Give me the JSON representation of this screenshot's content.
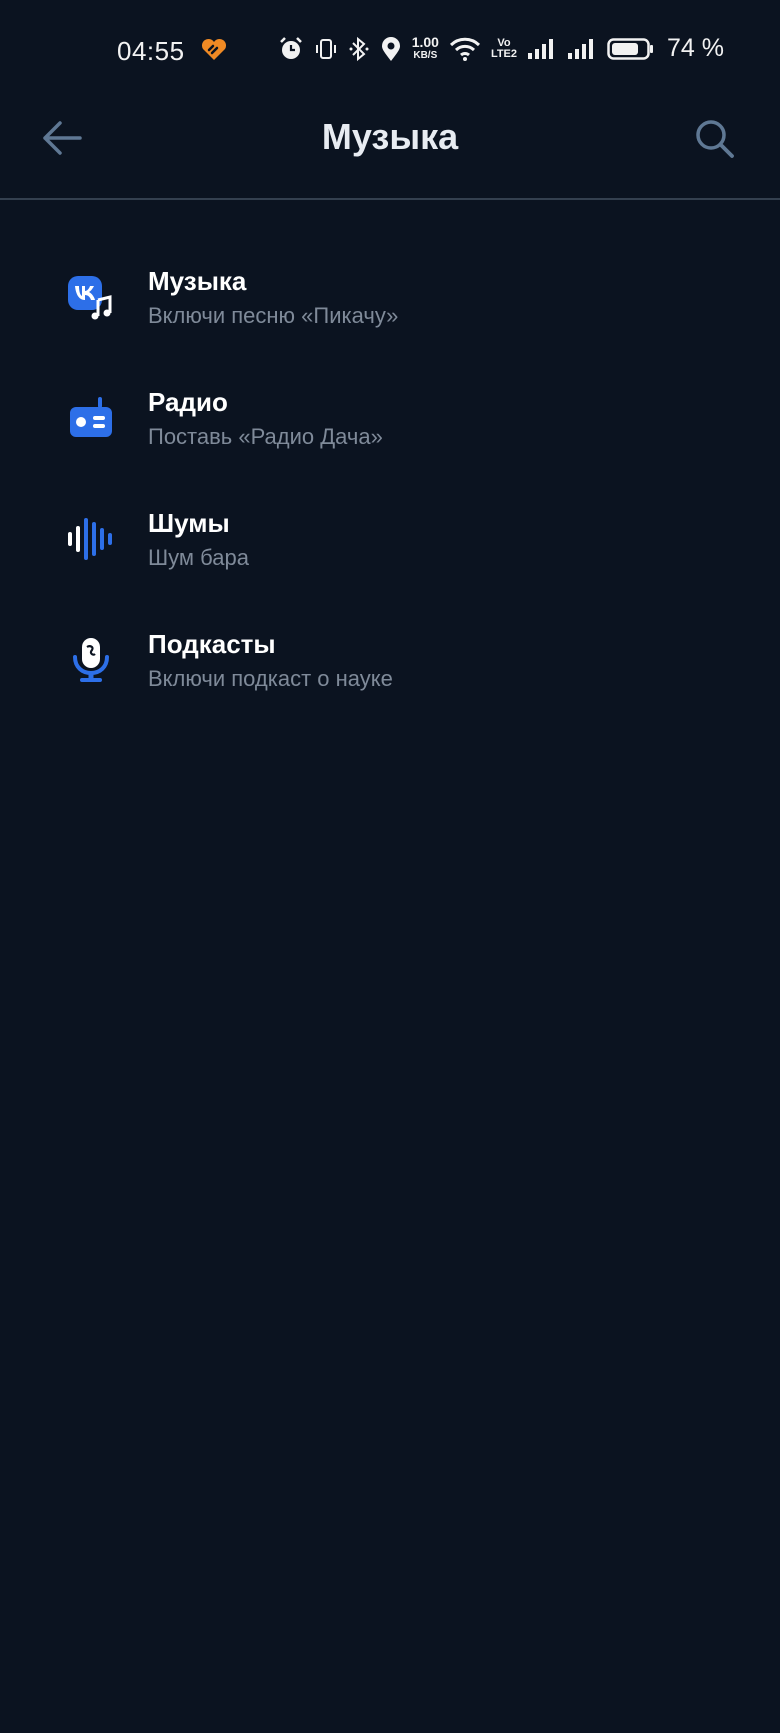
{
  "status_bar": {
    "time": "04:55",
    "net_speed_value": "1.00",
    "net_speed_unit": "KB/S",
    "volte_top": "Vo",
    "volte_bottom": "LTE2",
    "battery_percent": "74 %",
    "icons": [
      "app-heart-icon",
      "alarm-icon",
      "vibrate-icon",
      "bluetooth-icon",
      "location-icon",
      "wifi-icon",
      "signal-icon",
      "signal-icon",
      "battery-icon"
    ]
  },
  "header": {
    "title": "Музыка",
    "back_icon": "arrow-left-icon",
    "search_icon": "search-icon"
  },
  "items": [
    {
      "title": "Музыка",
      "subtitle": "Включи песню «Пикачу»",
      "icon": "vk-music-icon"
    },
    {
      "title": "Радио",
      "subtitle": "Поставь «Радио Дача»",
      "icon": "radio-icon"
    },
    {
      "title": "Шумы",
      "subtitle": "Шум бара",
      "icon": "sound-wave-icon"
    },
    {
      "title": "Подкасты",
      "subtitle": "Включи подкаст о науке",
      "icon": "microphone-icon"
    }
  ],
  "colors": {
    "background": "#0b1320",
    "accent": "#2d6fe8",
    "subtitle": "#7f8a99",
    "header_icon": "#5f7894"
  }
}
